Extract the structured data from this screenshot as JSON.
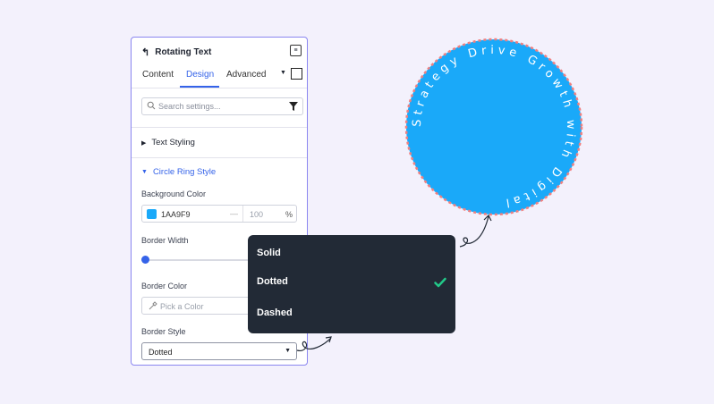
{
  "panel": {
    "title": "Rotating Text",
    "tabs": [
      "Content",
      "Design",
      "Advanced"
    ],
    "active_tab": "Design",
    "search_placeholder": "Search settings...",
    "sections": {
      "text_styling": "Text Styling",
      "circle_ring_style": "Circle Ring Style"
    },
    "background_color": {
      "label": "Background Color",
      "hex": "1AA9F9",
      "dash": "—",
      "opacity_placeholder": "100",
      "unit": "%"
    },
    "border_width": {
      "label": "Border Width",
      "value": 0
    },
    "border_color": {
      "label": "Border Color",
      "placeholder": "Pick a Color"
    },
    "border_style": {
      "label": "Border Style",
      "value": "Dotted"
    }
  },
  "dropdown": {
    "options": [
      "Solid",
      "Dotted",
      "Dashed"
    ],
    "selected": "Dotted"
  },
  "ring": {
    "text": "Strategy Drive Growth with Digital ",
    "fill_color": "#1aa9f9",
    "border_color": "#f08080",
    "border_style": "dashed"
  },
  "colors": {
    "accent": "#3563e9",
    "check": "#22c989",
    "dropdown_bg": "#222a36"
  },
  "icons": [
    "back-arrow-icon",
    "panel-menu-icon",
    "chevron-down-icon",
    "layout-square-icon",
    "search-icon",
    "filter-icon",
    "caret-right-icon",
    "caret-down-icon",
    "eyedropper-icon",
    "check-icon",
    "curly-arrow-icon"
  ]
}
